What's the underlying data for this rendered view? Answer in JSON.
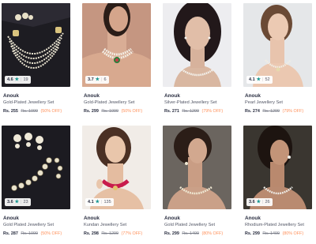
{
  "products": [
    {
      "brand": "Anouk",
      "name": "Gold-Plated Jewellery Set",
      "price": "Rs. 255",
      "mrp": "Rs. 1099",
      "discount": "(50% OFF)",
      "rating": "4.6",
      "count": "19",
      "icon": "jewellery-necklace-set-photo",
      "colors": {
        "bg": "#1d1c22",
        "accent": "#e8e0c8"
      }
    },
    {
      "brand": "Anouk",
      "name": "Gold-Plated Jewellery Set",
      "price": "Rs. 299",
      "mrp": "Rs. 1099",
      "discount": "(50% OFF)",
      "rating": "3.7",
      "count": "6",
      "icon": "model-choker-photo",
      "colors": {
        "bg": "#c59681",
        "accent": "#f3efe6"
      }
    },
    {
      "brand": "Anouk",
      "name": "Silver-Plated Jewellery Set",
      "price": "Rs. 271",
      "mrp": "Rs. 1299",
      "discount": "(79% OFF)",
      "rating": "",
      "count": "",
      "icon": "model-pearl-necklace-photo",
      "colors": {
        "bg": "#ededf0",
        "accent": "#f4f3ee"
      }
    },
    {
      "brand": "Anouk",
      "name": "Pearl Jewellery Set",
      "price": "Rs. 274",
      "mrp": "Rs. 1299",
      "discount": "(79% OFF)",
      "rating": "4.1",
      "count": "52",
      "icon": "model-pearl-set-photo",
      "colors": {
        "bg": "#e5e7e9",
        "accent": "#f1ede3"
      }
    },
    {
      "brand": "Anouk",
      "name": "Gold Plated Jewellery Set",
      "price": "Rs. 287",
      "mrp": "Rs. 1099",
      "discount": "(50% OFF)",
      "rating": "3.6",
      "count": "23",
      "icon": "kundan-necklace-set-photo",
      "colors": {
        "bg": "#1c1b21",
        "accent": "#efe9d8"
      }
    },
    {
      "brand": "Anouk",
      "name": "Kundan Jewellery Set",
      "price": "Rs. 298",
      "mrp": "Rs. 1299",
      "discount": "(77% OFF)",
      "rating": "4.1",
      "count": "135",
      "icon": "model-kundan-choker-photo",
      "colors": {
        "bg": "#f1ece7",
        "accent": "#c81b4c"
      }
    },
    {
      "brand": "Anouk",
      "name": "Gold Plated Jewellery Set",
      "price": "Rs. 299",
      "mrp": "Rs. 1499",
      "discount": "(80% OFF)",
      "rating": "",
      "count": "",
      "icon": "model-gold-set-photo",
      "colors": {
        "bg": "#6b655f",
        "accent": "#f0e9d4"
      }
    },
    {
      "brand": "Anouk",
      "name": "Rhodium-Plated Jewellery Set",
      "price": "Rs. 299",
      "mrp": "Rs. 1499",
      "discount": "(80% OFF)",
      "rating": "3.6",
      "count": "26",
      "icon": "model-rhodium-set-photo",
      "colors": {
        "bg": "#3a3630",
        "accent": "#efeee9"
      }
    }
  ],
  "rating_star": "★"
}
